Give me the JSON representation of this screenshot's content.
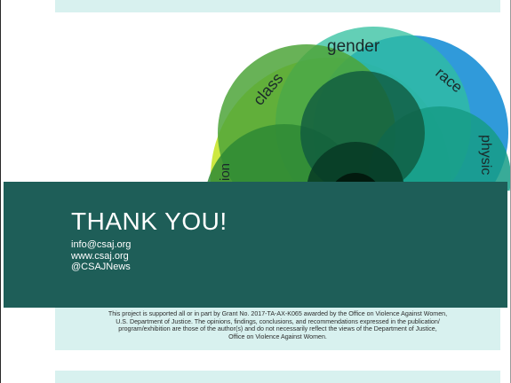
{
  "slide": {
    "title": "THANK YOU!",
    "contacts": [
      "info@csaj.org",
      "www.csaj.org",
      "@CSAJNews"
    ],
    "disclaimer": [
      "This project is supported all or in part by Grant No. 2017-TA-AX-K065 awarded by the Office on Violence Against Women,",
      "U.S. Department of Justice. The opinions, findings, conclusions, and recommendations expressed in the publication/",
      "program/exhibition are those of the author(s) and do not necessarily reflect the views of the Department of Justice,",
      "Office on Violence Against Women."
    ]
  },
  "graphic": {
    "labels": {
      "gender": "gender",
      "class": "class",
      "race": "race",
      "physical": "physic",
      "partial": "ion"
    },
    "colors": {
      "lime": "#c8e62c",
      "green": "#57a832",
      "blue": "#1a8fd6",
      "teal": "#2db88f",
      "panel": "#1e5e58",
      "band": "#d8f1ef"
    }
  }
}
